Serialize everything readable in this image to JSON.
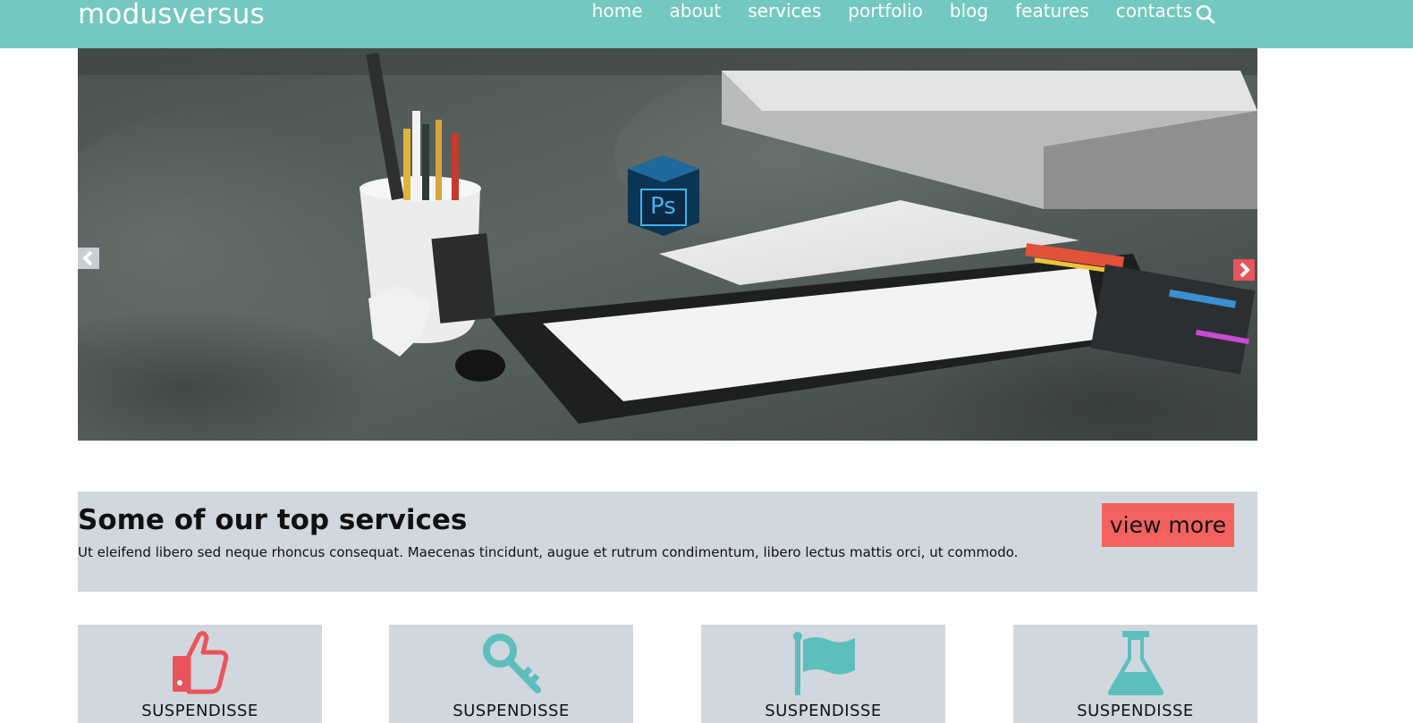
{
  "header": {
    "logo": "modusversus",
    "nav": [
      "home",
      "about",
      "services",
      "portfolio",
      "blog",
      "features",
      "contacts"
    ]
  },
  "icons": {
    "search": "search-icon",
    "prev": "chevron-left-icon",
    "next": "chevron-right-icon",
    "thumbs_up": "thumbs-up-icon",
    "key": "key-icon",
    "flag": "flag-icon",
    "flask": "flask-icon"
  },
  "slider": {
    "cube_label": "Ps"
  },
  "services": {
    "title": "Some of our top services",
    "description": "Ut eleifend libero sed neque rhoncus consequat. Maecenas tincidunt, augue et rutrum condimentum, libero lectus mattis orci, ut commodo.",
    "button": "view more"
  },
  "cards": [
    {
      "label": "SUSPENDISSE"
    },
    {
      "label": "SUSPENDISSE"
    },
    {
      "label": "SUSPENDISSE"
    },
    {
      "label": "SUSPENDISSE"
    }
  ],
  "colors": {
    "navbar": "#73c8c0",
    "panel": "#d1d7df",
    "accent": "#f3625f",
    "icon_red": "#e9545a",
    "icon_teal": "#5dbfbb"
  }
}
